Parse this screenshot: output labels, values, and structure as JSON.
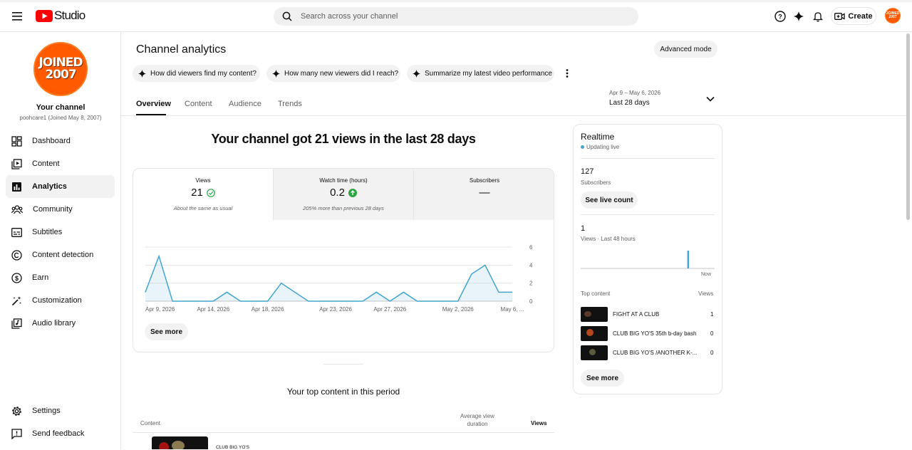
{
  "app": {
    "logo_text": "Studio",
    "search_placeholder": "Search across your channel",
    "create_label": "Create",
    "avatar_text": "JOINED 2007"
  },
  "channel": {
    "badge_text": "JOINED 2007",
    "name": "Your channel",
    "handle": "poohcare1 (Joined May 8, 2007)"
  },
  "sidebar": {
    "items": [
      {
        "label": "Dashboard",
        "icon": "dashboard-icon"
      },
      {
        "label": "Content",
        "icon": "content-icon"
      },
      {
        "label": "Analytics",
        "icon": "analytics-icon",
        "active": true
      },
      {
        "label": "Community",
        "icon": "community-icon"
      },
      {
        "label": "Subtitles",
        "icon": "subtitles-icon"
      },
      {
        "label": "Content detection",
        "icon": "copyright-icon"
      },
      {
        "label": "Earn",
        "icon": "earn-icon"
      },
      {
        "label": "Customization",
        "icon": "magic-wand-icon"
      },
      {
        "label": "Audio library",
        "icon": "audio-library-icon"
      }
    ],
    "settings": "Settings",
    "feedback": "Send feedback"
  },
  "page": {
    "title": "Channel analytics",
    "advanced_mode": "Advanced mode",
    "prompts": [
      "How did viewers find my content?",
      "How many new viewers did I reach?",
      "Summarize my latest video performance"
    ],
    "tabs": [
      "Overview",
      "Content",
      "Audience",
      "Trends"
    ],
    "date_range": "Apr 9 – May 6, 2026",
    "period": "Last 28 days",
    "headline": "Your channel got 21 views in the last 28 days"
  },
  "metrics": [
    {
      "label": "Views",
      "value": "21",
      "note": "About the same as usual",
      "status": "check"
    },
    {
      "label": "Watch time (hours)",
      "value": "0.2",
      "note": "205% more than previous 28 days",
      "status": "up"
    },
    {
      "label": "Subscribers",
      "value": "—",
      "note": ""
    }
  ],
  "chart_data": {
    "type": "area",
    "x_tick_labels": [
      "Apr 9, 2026",
      "Apr 14, 2026",
      "Apr 18, 2026",
      "Apr 23, 2026",
      "Apr 27, 2026",
      "May 2, 2026",
      "May 6, ..."
    ],
    "y_ticks": [
      0,
      2,
      4,
      6
    ],
    "ylim": [
      0,
      6
    ],
    "values": [
      1,
      5,
      0,
      0,
      0,
      0,
      1,
      0,
      0,
      0,
      2,
      1,
      0,
      0,
      0,
      0,
      0,
      1,
      0,
      1,
      0,
      0,
      0,
      0,
      3,
      4,
      1,
      1
    ],
    "color": "#41a5d0",
    "grid": true
  },
  "see_more": "See more",
  "top_content": {
    "title": "Your top content in this period",
    "col_content": "Content",
    "col_avg_1": "Average view",
    "col_avg_2": "duration",
    "col_views": "Views",
    "first_item": "CLUB BIG YO'S"
  },
  "realtime": {
    "title": "Realtime",
    "status": "Updating live",
    "subscribers_value": "127",
    "subscribers_label": "Subscribers",
    "see_live_count": "See live count",
    "views_value": "1",
    "views_label": "Views · Last 48 hours",
    "now_label": "Now",
    "bars": [
      0,
      0,
      0,
      0,
      0,
      0,
      0,
      0,
      0,
      0,
      0,
      0,
      0,
      0,
      0,
      0,
      0,
      0,
      0,
      0,
      0,
      0,
      0,
      0,
      0,
      0,
      0,
      0,
      0,
      0,
      0,
      0,
      0,
      0,
      0,
      0,
      0,
      0,
      1,
      0,
      0,
      0,
      0,
      0,
      0,
      0,
      0,
      0
    ],
    "top_content_label": "Top content",
    "views_col": "Views",
    "items": [
      {
        "title": "FIGHT AT A CLUB",
        "views": "1"
      },
      {
        "title": "CLUB BIG YO'S 35th b-day bash",
        "views": "0"
      },
      {
        "title": "CLUB BIG YO'S /ANOTHER K-...",
        "views": "0"
      }
    ],
    "see_more": "See more"
  }
}
